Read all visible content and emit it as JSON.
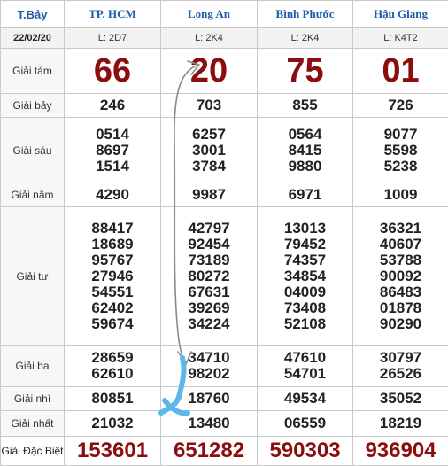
{
  "header": {
    "day": "T.Bảy",
    "date": "22/02/20",
    "provinces": [
      {
        "name": "TP. HCM",
        "code": "L: 2D7"
      },
      {
        "name": "Long An",
        "code": "L: 2K4"
      },
      {
        "name": "Bình Phước",
        "code": "L: 2K4"
      },
      {
        "name": "Hậu Giang",
        "code": "L: K4T2"
      }
    ]
  },
  "prizes": {
    "g8": {
      "label": "Giải tám",
      "values": [
        "66",
        "20",
        "75",
        "01"
      ]
    },
    "g7": {
      "label": "Giải bảy",
      "values": [
        "246",
        "703",
        "855",
        "726"
      ]
    },
    "g6": {
      "label": "Giải sáu",
      "values": [
        [
          "0514",
          "8697",
          "1514"
        ],
        [
          "6257",
          "3001",
          "3784"
        ],
        [
          "0564",
          "8415",
          "9880"
        ],
        [
          "9077",
          "5598",
          "5238"
        ]
      ]
    },
    "g5": {
      "label": "Giải năm",
      "values": [
        "4290",
        "9987",
        "6971",
        "1009"
      ]
    },
    "g4": {
      "label": "Giải tư",
      "values": [
        [
          "88417",
          "18689",
          "95767",
          "27946",
          "54551",
          "62402",
          "59674"
        ],
        [
          "42797",
          "92454",
          "73189",
          "80272",
          "67631",
          "39269",
          "34224"
        ],
        [
          "13013",
          "79452",
          "74357",
          "34854",
          "04009",
          "73408",
          "52108"
        ],
        [
          "36321",
          "40607",
          "53788",
          "90092",
          "86483",
          "01878",
          "90290"
        ]
      ]
    },
    "g3": {
      "label": "Giải ba",
      "values": [
        [
          "28659",
          "62610"
        ],
        [
          "34710",
          "98202"
        ],
        [
          "47610",
          "54701"
        ],
        [
          "30797",
          "26526"
        ]
      ]
    },
    "g2": {
      "label": "Giải nhì",
      "values": [
        "80851",
        "18760",
        "49534",
        "35052"
      ]
    },
    "g1": {
      "label": "Giải nhất",
      "values": [
        "21032",
        "13480",
        "06559",
        "18219"
      ]
    },
    "db": {
      "label": "Giải Đặc Biệt",
      "values": [
        "153601",
        "651282",
        "590303",
        "936904"
      ]
    }
  },
  "annotations": {
    "arrow_color": "#8a8a8a",
    "scribble_color": "#5fb6ea"
  }
}
